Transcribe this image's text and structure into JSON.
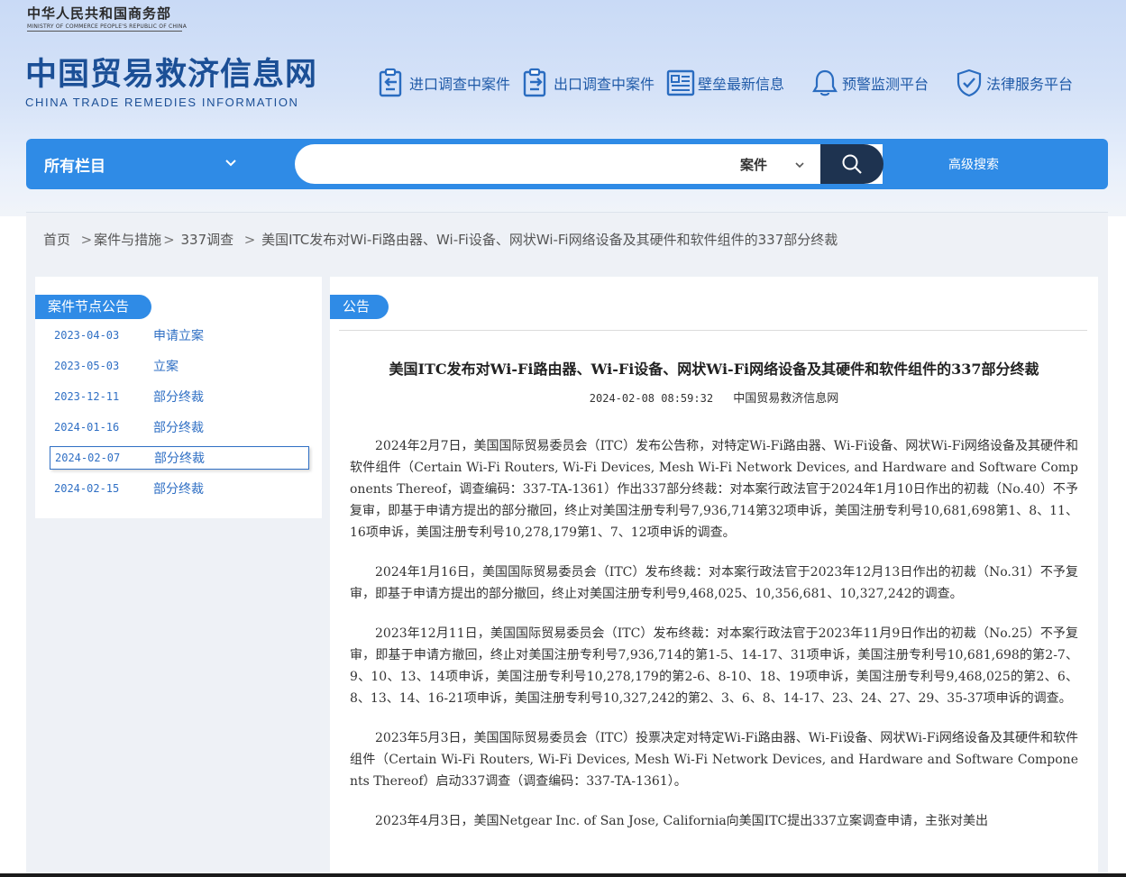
{
  "header": {
    "ministry_cn": "中华人民共和国商务部",
    "ministry_en": "MINISTRY OF COMMERCE PEOPLE'S REPUBLIC OF CHINA",
    "site_cn": "中国贸易救济信息网",
    "site_en": "CHINA TRADE REMEDIES INFORMATION",
    "nav": [
      {
        "label": "进口调查中案件",
        "icon": "import-clipboard-icon"
      },
      {
        "label": "出口调查中案件",
        "icon": "export-clipboard-icon"
      },
      {
        "label": "壁垒最新信息",
        "icon": "news-document-icon"
      },
      {
        "label": "预警监测平台",
        "icon": "bell-icon"
      },
      {
        "label": "法律服务平台",
        "icon": "shield-check-icon"
      }
    ]
  },
  "search": {
    "category": "所有栏目",
    "query": "",
    "type": "案件",
    "advanced": "高级搜索"
  },
  "breadcrumb": {
    "home": "首页",
    "level1": "案件与措施",
    "level2": "337调查",
    "current": "美国ITC发布对Wi-Fi路由器、Wi-Fi设备、网状Wi-Fi网络设备及其硬件和软件组件的337部分终裁"
  },
  "sidebar": {
    "title": "案件节点公告",
    "items": [
      {
        "date": "2023-04-03",
        "type": "申请立案",
        "active": false
      },
      {
        "date": "2023-05-03",
        "type": "立案",
        "active": false
      },
      {
        "date": "2023-12-11",
        "type": "部分终裁",
        "active": false
      },
      {
        "date": "2024-01-16",
        "type": "部分终裁",
        "active": false
      },
      {
        "date": "2024-02-07",
        "type": "部分终裁",
        "active": true
      },
      {
        "date": "2024-02-15",
        "type": "部分终裁",
        "active": false
      }
    ]
  },
  "article": {
    "section": "公告",
    "title": "美国ITC发布对Wi-Fi路由器、Wi-Fi设备、网状Wi-Fi网络设备及其硬件和软件组件的337部分终裁",
    "time": "2024-02-08 08:59:32",
    "source": "中国贸易救济信息网",
    "paragraphs": [
      "2024年2月7日，美国国际贸易委员会（ITC）发布公告称，对特定Wi-Fi路由器、Wi-Fi设备、网状Wi-Fi网络设备及其硬件和软件组件（Certain Wi-Fi Routers, Wi-Fi Devices, Mesh Wi-Fi Network Devices, and Hardware and Software Components Thereof，调查编码：337-TA-1361）作出337部分终裁：对本案行政法官于2024年1月10日作出的初裁（No.40）不予复审，即基于申请方提出的部分撤回，终止对美国注册专利号7,936,714第32项申诉，美国注册专利号10,681,698第1、8、11、16项申诉，美国注册专利号10,278,179第1、7、12项申诉的调查。",
      "2024年1月16日，美国国际贸易委员会（ITC）发布终裁：对本案行政法官于2023年12月13日作出的初裁（No.31）不予复审，即基于申请方提出的部分撤回，终止对美国注册专利号9,468,025、10,356,681、10,327,242的调查。",
      "2023年12月11日，美国国际贸易委员会（ITC）发布终裁：对本案行政法官于2023年11月9日作出的初裁（No.25）不予复审，即基于申请方撤回，终止对美国注册专利号7,936,714的第1-5、14-17、31项申诉，美国注册专利号10,681,698的第2-7、9、10、13、14项申诉，美国注册专利号10,278,179的第2-6、8-10、18、19项申诉，美国注册专利号9,468,025的第2、6、8、13、14、16-21项申诉，美国注册专利号10,327,242的第2、3、6、8、14-17、23、24、27、29、35-37项申诉的调查。",
      "2023年5月3日，美国国际贸易委员会（ITC）投票决定对特定Wi-Fi路由器、Wi-Fi设备、网状Wi-Fi网络设备及其硬件和软件组件（Certain Wi-Fi Routers, Wi-Fi Devices, Mesh Wi-Fi Network Devices, and Hardware and Software Components Thereof）启动337调查（调查编码：337-TA-1361）。",
      "2023年4月3日，美国Netgear Inc. of San Jose, California向美国ITC提出337立案调查申请，主张对美出"
    ]
  },
  "colors": {
    "brand_blue": "#2f8be6",
    "logo_blue": "#1b4f96",
    "search_button": "#1e3350",
    "link_blue": "#2f6fc4"
  }
}
